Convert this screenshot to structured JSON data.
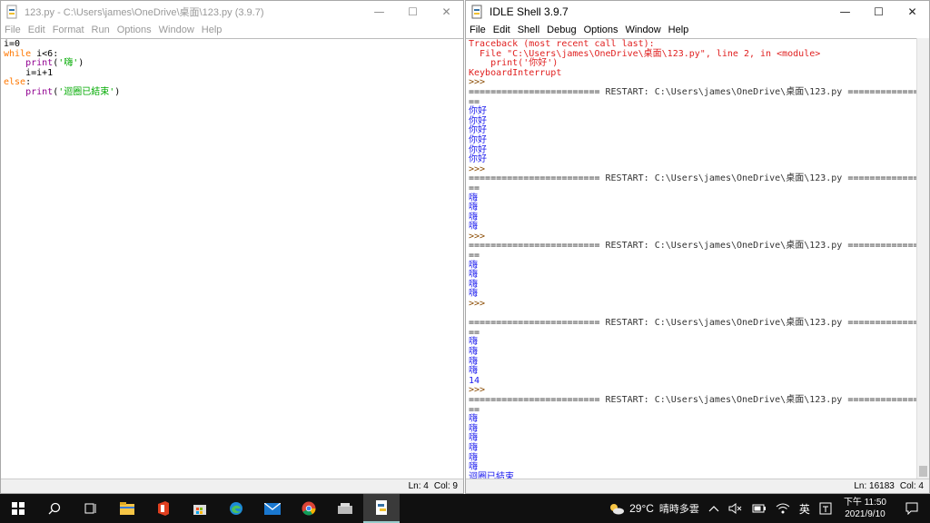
{
  "editor": {
    "title": "123.py - C:\\Users\\james\\OneDrive\\桌面\\123.py (3.9.7)",
    "menu": [
      "File",
      "Edit",
      "Format",
      "Run",
      "Options",
      "Window",
      "Help"
    ],
    "controls": {
      "minimize": "—",
      "maximize": "☐",
      "close": "✕"
    },
    "code": [
      [
        {
          "t": "i=0",
          "c": "black"
        }
      ],
      [
        {
          "t": "while",
          "c": "kw"
        },
        {
          "t": " i<6:",
          "c": "black"
        }
      ],
      [
        {
          "t": "    ",
          "c": "black"
        },
        {
          "t": "print",
          "c": "builtin"
        },
        {
          "t": "(",
          "c": "black"
        },
        {
          "t": "'嗨'",
          "c": "str"
        },
        {
          "t": ")",
          "c": "black"
        }
      ],
      [
        {
          "t": "    i=i+1",
          "c": "black"
        }
      ],
      [
        {
          "t": "else",
          "c": "kw"
        },
        {
          "t": ":",
          "c": "black"
        }
      ],
      [
        {
          "t": "    ",
          "c": "black"
        },
        {
          "t": "print",
          "c": "builtin"
        },
        {
          "t": "(",
          "c": "black"
        },
        {
          "t": "'迴圈已結束'",
          "c": "str"
        },
        {
          "t": ")",
          "c": "black"
        }
      ]
    ],
    "status": {
      "ln": "Ln: 4",
      "col": "Col: 9"
    }
  },
  "shell": {
    "title": "IDLE Shell 3.9.7",
    "menu": [
      "File",
      "Edit",
      "Shell",
      "Debug",
      "Options",
      "Window",
      "Help"
    ],
    "controls": {
      "minimize": "—",
      "maximize": "☐",
      "close": "✕"
    },
    "lines": [
      {
        "t": "Traceback (most recent call last):",
        "c": "err"
      },
      {
        "t": "  File \"C:\\Users\\james\\OneDrive\\桌面\\123.py\", line 2, in <module>",
        "c": "err"
      },
      {
        "t": "    print('你好')",
        "c": "err"
      },
      {
        "t": "KeyboardInterrupt",
        "c": "err"
      },
      {
        "t": ">>> ",
        "c": "prompt"
      },
      {
        "t": "======================== RESTART: C:\\Users\\james\\OneDrive\\桌面\\123.py ========================",
        "c": "restart"
      },
      {
        "t": "==",
        "c": "restart"
      },
      {
        "t": "你好",
        "c": "out"
      },
      {
        "t": "你好",
        "c": "out"
      },
      {
        "t": "你好",
        "c": "out"
      },
      {
        "t": "你好",
        "c": "out"
      },
      {
        "t": "你好",
        "c": "out"
      },
      {
        "t": "你好",
        "c": "out"
      },
      {
        "t": ">>> ",
        "c": "prompt"
      },
      {
        "t": "======================== RESTART: C:\\Users\\james\\OneDrive\\桌面\\123.py ========================",
        "c": "restart"
      },
      {
        "t": "==",
        "c": "restart"
      },
      {
        "t": "嗨",
        "c": "out"
      },
      {
        "t": "嗨",
        "c": "out"
      },
      {
        "t": "嗨",
        "c": "out"
      },
      {
        "t": "嗨",
        "c": "out"
      },
      {
        "t": ">>> ",
        "c": "prompt"
      },
      {
        "t": "======================== RESTART: C:\\Users\\james\\OneDrive\\桌面\\123.py ========================",
        "c": "restart"
      },
      {
        "t": "==",
        "c": "restart"
      },
      {
        "t": "嗨",
        "c": "out"
      },
      {
        "t": "嗨",
        "c": "out"
      },
      {
        "t": "嗨",
        "c": "out"
      },
      {
        "t": "嗨",
        "c": "out"
      },
      {
        "t": ">>> ",
        "c": "prompt"
      },
      {
        "t": "",
        "c": "black"
      },
      {
        "t": "======================== RESTART: C:\\Users\\james\\OneDrive\\桌面\\123.py ========================",
        "c": "restart"
      },
      {
        "t": "==",
        "c": "restart"
      },
      {
        "t": "嗨",
        "c": "out"
      },
      {
        "t": "嗨",
        "c": "out"
      },
      {
        "t": "嗨",
        "c": "out"
      },
      {
        "t": "嗨",
        "c": "out"
      },
      {
        "t": "14",
        "c": "out"
      },
      {
        "t": ">>> ",
        "c": "prompt"
      },
      {
        "t": "======================== RESTART: C:\\Users\\james\\OneDrive\\桌面\\123.py ========================",
        "c": "restart"
      },
      {
        "t": "==",
        "c": "restart"
      },
      {
        "t": "嗨",
        "c": "out"
      },
      {
        "t": "嗨",
        "c": "out"
      },
      {
        "t": "嗨",
        "c": "out"
      },
      {
        "t": "嗨",
        "c": "out"
      },
      {
        "t": "嗨",
        "c": "out"
      },
      {
        "t": "嗨",
        "c": "out"
      },
      {
        "t": "迴圈已結束",
        "c": "out"
      },
      {
        "t": ">>> ",
        "c": "prompt",
        "cursor": true
      }
    ],
    "status": {
      "ln": "Ln: 16183",
      "col": "Col: 4"
    }
  },
  "taskbar": {
    "apps": [
      "windows-start-icon",
      "search-icon",
      "task-view-icon",
      "file-explorer-icon",
      "office-icon",
      "microsoft-store-icon",
      "edge-icon",
      "mail-icon",
      "chrome-icon",
      "app-icon",
      "idle-icon"
    ],
    "weather_temp": "29°C",
    "weather_desc": "晴時多雲",
    "ime": "英",
    "time": "下午 11:50",
    "date": "2021/9/10"
  },
  "colors": {
    "keyword": "#ff7700",
    "builtin": "#900090",
    "string": "#00aa00",
    "error": "#e02020",
    "output": "#1a1aee",
    "taskbar_bg": "#101010"
  }
}
